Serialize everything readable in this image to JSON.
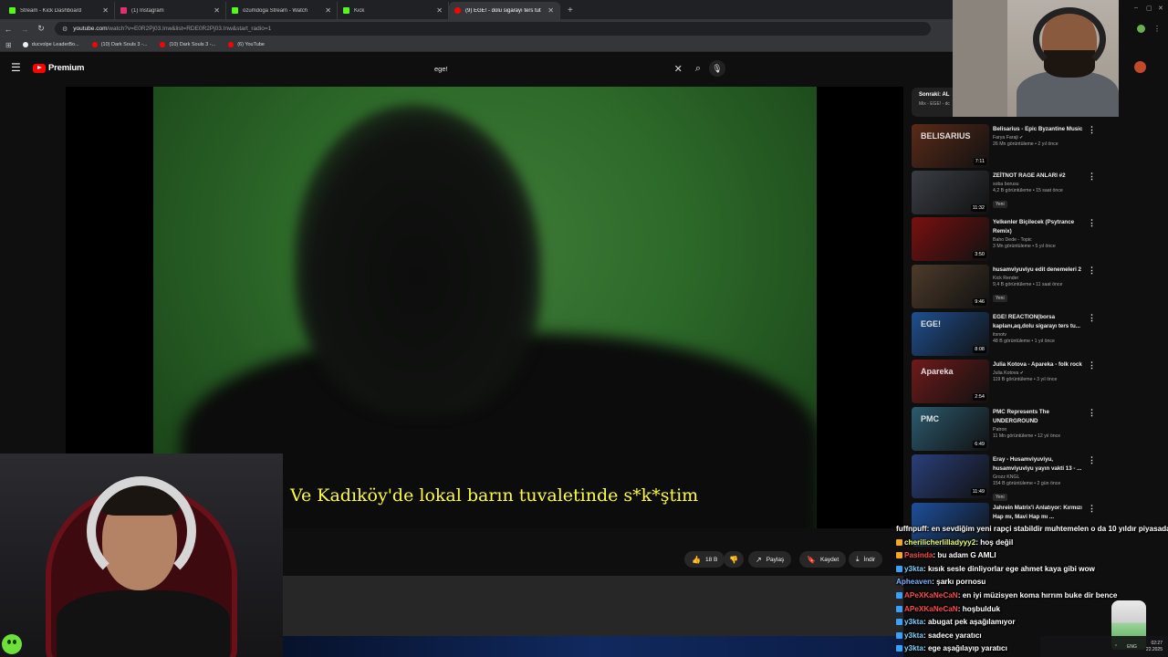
{
  "browser": {
    "tabs": [
      {
        "title": "Stream - Kick Dashboard",
        "color": "#53fc18"
      },
      {
        "title": "(1) Instagram",
        "color": "#e1306c"
      },
      {
        "title": "ozumdoga Stream - Watch",
        "color": "#53fc18"
      },
      {
        "title": "Kick",
        "color": "#53fc18"
      },
      {
        "title": "(9) EGE! - dolu sigarayı ters tut",
        "color": "#ff0000"
      }
    ],
    "url": "youtube.com",
    "url_path": "/watch?v=E0R2Pj03.Inw&list=RDE0R2Pj03.Inw&start_radio=1",
    "bookmarks": [
      {
        "label": "ducvolpe LeaderBo...",
        "color": "#f0f0f0"
      },
      {
        "label": "(10) Dark Souls 3 -...",
        "color": "#ff0000"
      },
      {
        "label": "(10) Dark Souls 3 -...",
        "color": "#ff0000"
      },
      {
        "label": "(6) YouTube",
        "color": "#ff0000"
      }
    ]
  },
  "youtube": {
    "brand": "Premium",
    "search_value": "ege!",
    "subtitle": "Ve Kadıköy'de lokal barın tuvaletinde s*k*ştim",
    "actions": {
      "likes": "18 B",
      "share": "Paylaş",
      "save": "Kaydet",
      "download": "İndir"
    },
    "up_next": {
      "label": "Sonraki: AL",
      "sub": "Mix - EGE! - dc"
    },
    "recommendations": [
      {
        "title": "Belisarius - Epic Byzantine Music",
        "channel": "Farya Faraji",
        "verified": true,
        "stats": "26 Mn görüntüleme • 2 yıl önce",
        "duration": "7:11",
        "new": "",
        "thumb": "#5a2a18",
        "thumb_text": "BELISARIUS"
      },
      {
        "title": "ZEİTNOT RAGE ANLARI #2",
        "channel": "soba borusu",
        "verified": false,
        "stats": "4,2 B görüntüleme • 15 saat önce",
        "duration": "11:32",
        "new": "Yeni",
        "thumb": "#3a3e44",
        "thumb_text": ""
      },
      {
        "title": "Yelkenler Biçilecek (Psytrance Remix)",
        "channel": "Baho Dede - Topic",
        "verified": false,
        "stats": "3 Mn görüntüleme • 5 yıl önce",
        "duration": "3:50",
        "new": "",
        "thumb": "#7a1010",
        "thumb_text": ""
      },
      {
        "title": "husamviyuviyu edit denemeleri 2",
        "channel": "Kick Render",
        "verified": false,
        "stats": "9,4 B görüntüleme • 11 saat önce",
        "duration": "9:46",
        "new": "Yeni",
        "thumb": "#4d3b2a",
        "thumb_text": ""
      },
      {
        "title": "EGE! REACTION(borsa kaplanı,aq,dolu sigarayı ters tu...",
        "channel": "itsnotv",
        "verified": false,
        "stats": "48 B görüntüleme • 1 yıl önce",
        "duration": "8:08",
        "new": "",
        "thumb": "#1f4f8f",
        "thumb_text": "EGE!"
      },
      {
        "title": "Julia Kotova - Apareka - folk rock",
        "channel": "Julia Kotova",
        "verified": true,
        "stats": "119 B görüntüleme • 3 yıl önce",
        "duration": "2:54",
        "new": "",
        "thumb": "#6e1a1a",
        "thumb_text": "Apareka"
      },
      {
        "title": "PMC Represents The UNDERGROUND",
        "channel": "Patron",
        "verified": false,
        "stats": "11 Mn görüntüleme • 12 yıl önce",
        "duration": "6:49",
        "new": "",
        "thumb": "#2c5a6e",
        "thumb_text": "PMC"
      },
      {
        "title": "Eray - Husamviyuviyu, husamviyuviyu yayın vakti 13 - ...",
        "channel": "Grozz KNGL",
        "verified": false,
        "stats": "154 B görüntüleme • 2 gün önce",
        "duration": "11:49",
        "new": "Yeni",
        "thumb": "#2a3f7a",
        "thumb_text": ""
      },
      {
        "title": "Jahrein Matrix'i Anlatıyor: Kırmızı Hap mı, Mavi Hap mı ...",
        "channel": "",
        "verified": false,
        "stats": "",
        "duration": "",
        "new": "",
        "thumb": "#1d4f9c",
        "thumb_text": ""
      }
    ]
  },
  "chat": [
    {
      "user": "fuffnpuff",
      "text": ": en sevdiğim yeni rapçi stabildir muhtemelen o da 10 yıldır piyasada",
      "color": "#ffffff",
      "badge": ""
    },
    {
      "user": "cherilicherlilladyyy2",
      "text": ": hoş değil",
      "color": "#f0ff6a",
      "badge": "#f5a623"
    },
    {
      "user": "Pasinda",
      "text": ": bu adam G AMLI",
      "color": "#ff4a4a",
      "badge": "#f5a623"
    },
    {
      "user": "y3kta",
      "text": ": kısık sesle dinliyorlar ege ahmet kaya gibi wow",
      "color": "#7fd1ff",
      "badge": "#3aa0ff"
    },
    {
      "user": "Apheaven",
      "text": ": şarkı pornosu",
      "color": "#7fb0ff",
      "badge": ""
    },
    {
      "user": "APeXKaNeCaN",
      "text": ": en iyi müzisyen koma hırrım buke dir bence",
      "color": "#ff4a4a",
      "badge": "#3aa0ff"
    },
    {
      "user": "APeXKaNeCaN",
      "text": ": hoşbulduk",
      "color": "#ff4a4a",
      "badge": "#3aa0ff"
    },
    {
      "user": "y3kta",
      "text": ": abugat pek aşağılamıyor",
      "color": "#7fd1ff",
      "badge": "#3aa0ff"
    },
    {
      "user": "y3kta",
      "text": ": sadece yaratıcı",
      "color": "#7fd1ff",
      "badge": "#3aa0ff"
    },
    {
      "user": "y3kta",
      "text": ": ege aşağılayıp yaratıcı",
      "color": "#7fd1ff",
      "badge": "#3aa0ff"
    }
  ],
  "taskbar": {
    "lang": "ENG",
    "time": "02:27",
    "date": "22.2025"
  }
}
